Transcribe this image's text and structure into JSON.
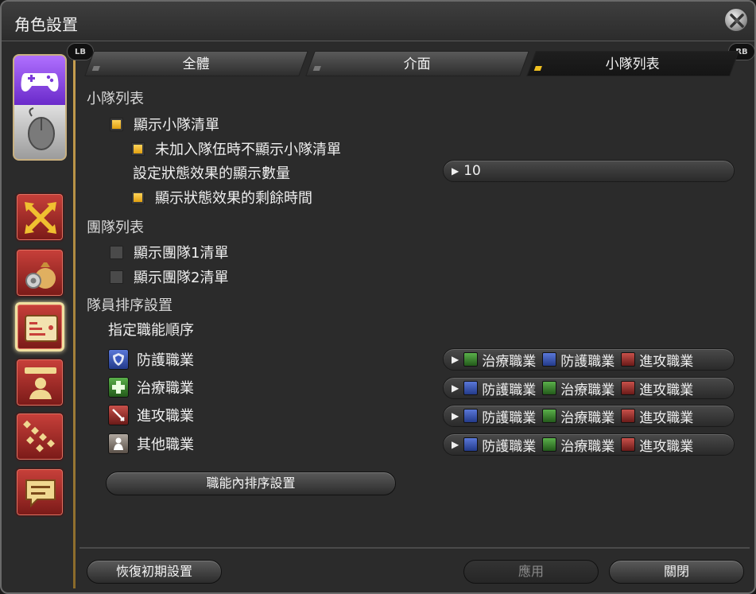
{
  "window": {
    "title": "角色設置"
  },
  "tabs": {
    "lb": "LB",
    "rb": "RB",
    "items": [
      {
        "label": "全體",
        "active": false
      },
      {
        "label": "介面",
        "active": false
      },
      {
        "label": "小隊列表",
        "active": true
      }
    ]
  },
  "party_list": {
    "heading": "小隊列表",
    "show_party_list": {
      "label": "顯示小隊清單",
      "checked": true
    },
    "hide_when_solo": {
      "label": "未加入隊伍時不顯示小隊清單",
      "checked": true
    },
    "status_count": {
      "label": "設定狀態效果的顯示數量",
      "value": "10"
    },
    "show_status_timers": {
      "label": "顯示狀態效果的剩餘時間",
      "checked": true
    }
  },
  "alliance_list": {
    "heading": "團隊列表",
    "show_alliance_1": {
      "label": "顯示團隊1清單",
      "checked": false
    },
    "show_alliance_2": {
      "label": "顯示團隊2清單",
      "checked": false
    }
  },
  "sort": {
    "heading": "隊員排序設置",
    "subheading": "指定職能順序",
    "roles": [
      {
        "label": "防護職業",
        "icon": "tank-icon",
        "order": [
          "治療職業",
          "防護職業",
          "進攻職業"
        ],
        "order_icons": [
          "heal-icon",
          "tank-icon",
          "dps-icon"
        ]
      },
      {
        "label": "治療職業",
        "icon": "heal-icon",
        "order": [
          "防護職業",
          "治療職業",
          "進攻職業"
        ],
        "order_icons": [
          "tank-icon",
          "heal-icon",
          "dps-icon"
        ]
      },
      {
        "label": "進攻職業",
        "icon": "dps-icon",
        "order": [
          "防護職業",
          "治療職業",
          "進攻職業"
        ],
        "order_icons": [
          "tank-icon",
          "heal-icon",
          "dps-icon"
        ]
      },
      {
        "label": "其他職業",
        "icon": "other-icon",
        "order": [
          "防護職業",
          "治療職業",
          "進攻職業"
        ],
        "order_icons": [
          "tank-icon",
          "heal-icon",
          "dps-icon"
        ]
      }
    ],
    "in_role_button": "職能內排序設置"
  },
  "footer": {
    "reset": "恢復初期設置",
    "apply": "應用",
    "close": "關閉"
  },
  "colors": {
    "accent_gold": "#f0c020",
    "rail_red": "#c8403a",
    "device_purple": "#8a4ae8"
  }
}
